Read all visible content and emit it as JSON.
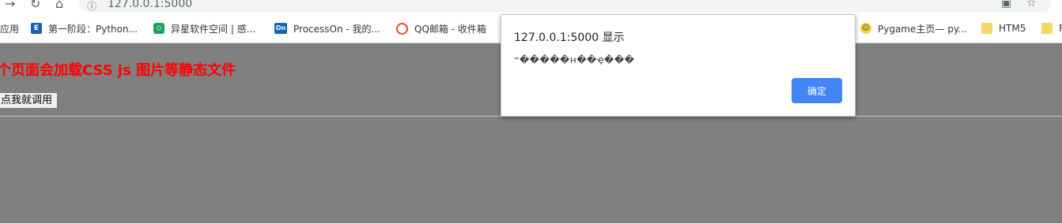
{
  "browser": {
    "url": "127.0.0.1:5000"
  },
  "bookmarks": [
    {
      "label": "应用",
      "icon": "apps-icon"
    },
    {
      "label": "第一阶段：Python...",
      "icon": "bookmark-e-icon"
    },
    {
      "label": "异星软件空间 | 感...",
      "icon": "bookmark-shield-icon"
    },
    {
      "label": "ProcessOn - 我的...",
      "icon": "processon-icon"
    },
    {
      "label": "QQ邮箱 - 收件箱",
      "icon": "qqmail-icon"
    },
    {
      "label": "Pygame主页— py...",
      "icon": "pygame-icon"
    },
    {
      "label": "HTM5",
      "icon": "folder-icon"
    },
    {
      "label": "F",
      "icon": "folder-icon"
    }
  ],
  "page": {
    "heading": "个页面会加载CSS js 图片等静态文件",
    "button_label": "点我就调用"
  },
  "dialog": {
    "title": "127.0.0.1:5000 显示",
    "message": "⁼�����н��ҿ���",
    "ok_label": "确定"
  },
  "colors": {
    "page_background": "#808080",
    "heading": "#ff0000",
    "dialog_button": "#4285f4"
  }
}
